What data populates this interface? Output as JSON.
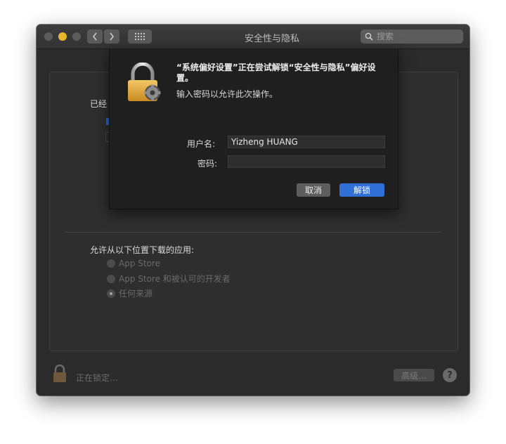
{
  "window": {
    "title": "安全性与隐私"
  },
  "search": {
    "placeholder": "搜索"
  },
  "background": {
    "already_label": "已经",
    "allow_apps_label": "允许从以下位置下载的应用:",
    "options": [
      {
        "label": "App Store",
        "selected": false
      },
      {
        "label": "App Store 和被认可的开发者",
        "selected": false
      },
      {
        "label": "任何来源",
        "selected": true
      }
    ],
    "locking_status": "正在锁定…",
    "advanced_label": "高级…",
    "help_label": "?"
  },
  "dialog": {
    "message": "“系统偏好设置”正在尝试解锁“安全性与隐私”偏好设置。",
    "submessage": "输入密码以允许此次操作。",
    "username_label": "用户名:",
    "username_value": "Yizheng HUANG",
    "password_label": "密码:",
    "password_value": "",
    "cancel_label": "取消",
    "unlock_label": "解锁"
  },
  "colors": {
    "accent": "#2f6fd6",
    "lock_gold": "#e0a93a",
    "minimize": "#e8b730"
  },
  "icons": [
    "lock-icon",
    "gear-icon",
    "search-icon",
    "chevron-left-icon",
    "chevron-right-icon",
    "grid-icon",
    "help-icon"
  ]
}
